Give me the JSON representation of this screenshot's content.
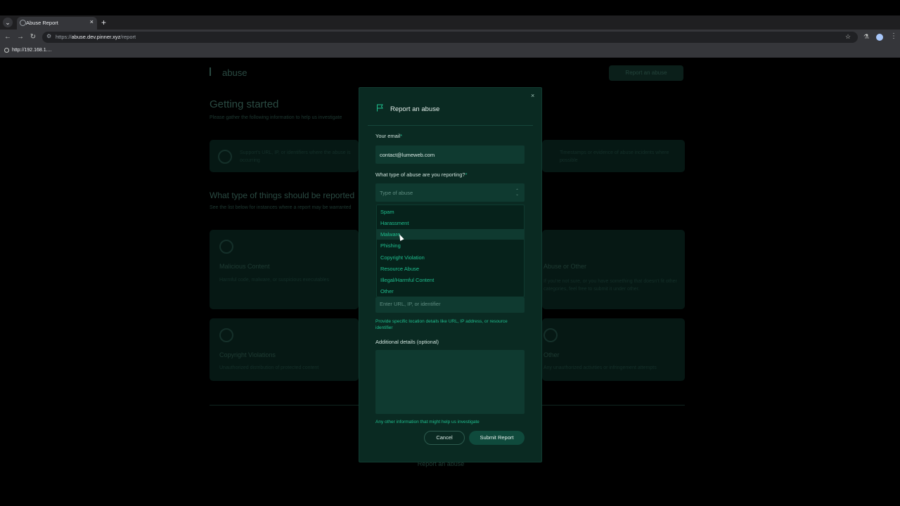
{
  "browser": {
    "tab_title": "Abuse Report",
    "tab_close": "×",
    "new_tab": "+",
    "url_prefix": "https://",
    "url_host": "abuse.dev.pinner.xyz",
    "url_path": "/report",
    "status_url": "http://192.168.1....",
    "icons": [
      "chevron-down-icon",
      "close-icon",
      "plus-icon",
      "back-icon",
      "forward-icon",
      "reload-icon",
      "site-info-icon",
      "star-icon",
      "lab-icon",
      "profile-icon",
      "menu-icon"
    ]
  },
  "background_page": {
    "logo_text": "abuse",
    "header_cta": "Report an abuse",
    "heading": "Getting started",
    "subheading": "Please gather the following information to help us investigate",
    "card1_text": "Support's URL, IP, or identifiers where the abuse is occurring",
    "card2_text": "Timestamps or evidence of abuse incidents where possible",
    "section_heading": "What type of things should be reported",
    "section_sub": "See the list below for instances where a report may be warranted",
    "type_cards": [
      {
        "title": "Malicious Content",
        "text": "Harmful code, malware, or suspicious executables"
      },
      {
        "title": "Abuse or Other",
        "text": "If you're not sure, or you have something that doesn't fit other categories, feel free to submit it under other."
      },
      {
        "title": "Copyright Violations",
        "text": "Unauthorized distribution of protected content"
      },
      {
        "title": "Other",
        "text": "Any unauthorized activities or infringement attempts"
      }
    ],
    "footer_cta": "Report an abuse"
  },
  "modal": {
    "title": "Report an abuse",
    "close": "×",
    "email_label": "Your email",
    "required_mark": "*",
    "email_value": "contact@lumeweb.com",
    "type_label": "What type of abuse are you reporting?",
    "type_placeholder": "Type of abuse",
    "type_options": [
      "Spam",
      "Harassment",
      "Malware",
      "Phishing",
      "Copyright Violation",
      "Resource Abuse",
      "Illegal/Harmful Content",
      "Other"
    ],
    "hovered_option": "Malware",
    "location_placeholder": "Enter URL, IP, or identifier",
    "location_help": "Provide specific location details like URL, IP address, or resource identifier",
    "details_label": "Additional details (optional)",
    "details_help": "Any other information that might help us investigate",
    "cancel_label": "Cancel",
    "submit_label": "Submit Report"
  },
  "colors": {
    "accent": "#1fbf8f",
    "modal_bg": "#0a2a22",
    "input_bg": "#0f3a30"
  }
}
